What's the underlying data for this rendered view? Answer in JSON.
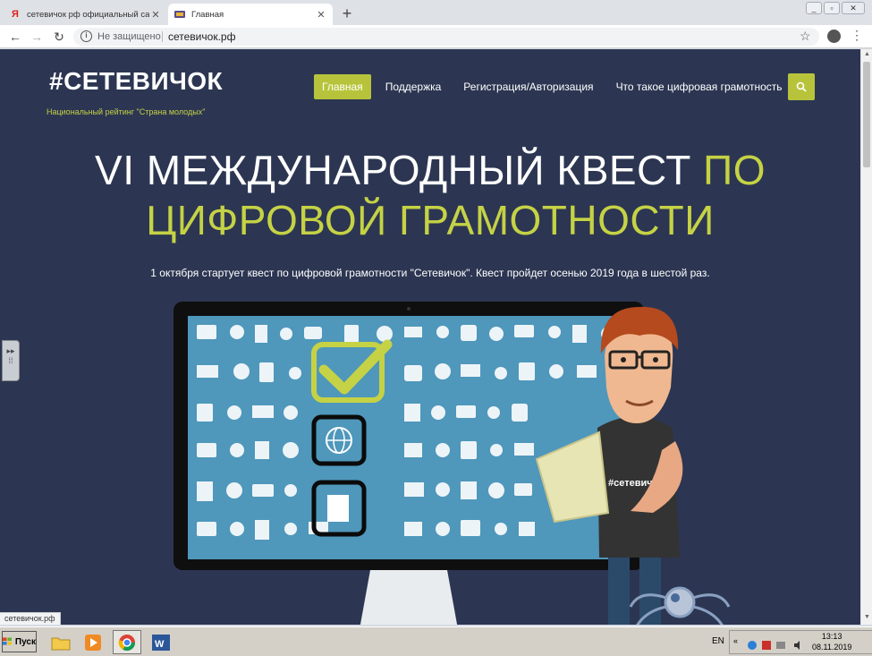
{
  "browser": {
    "tabs": [
      {
        "title": "сетевичок рф официальный сайт",
        "favicon": "yandex-icon",
        "active": false
      },
      {
        "title": "Главная",
        "favicon": "site-icon",
        "active": true
      }
    ],
    "address": {
      "security_label": "Не защищено",
      "url": "сетевичок.рф"
    },
    "status_url": "сетевичок.рф"
  },
  "site": {
    "logo": "#СЕТЕВИЧОК",
    "tagline": "Национальный рейтинг \"Страна молодых\"",
    "nav": [
      {
        "label": "Главная",
        "active": true
      },
      {
        "label": "Поддержка",
        "active": false
      },
      {
        "label": "Регистрация/Авторизация",
        "active": false
      },
      {
        "label": "Что такое цифровая грамотность",
        "active": false
      }
    ],
    "hero": {
      "line1_white": "VI МЕЖДУНАРОДНЫЙ КВЕСТ",
      "line1_accent": "ПО",
      "line2_accent": "ЦИФРОВОЙ ГРАМОТНОСТИ"
    },
    "subtitle": "1 октября стартует квест по цифровой грамотности \"Сетевичок\". Квест пройдет осенью 2019 года в шестой раз.",
    "mascot_shirt": "#сетевичок",
    "colors": {
      "background": "#2c3652",
      "accent": "#c5d245",
      "button": "#b7c43b"
    }
  },
  "taskbar": {
    "start_label": "Пуск",
    "language": "EN",
    "time": "13:13",
    "date": "08.11.2019"
  }
}
